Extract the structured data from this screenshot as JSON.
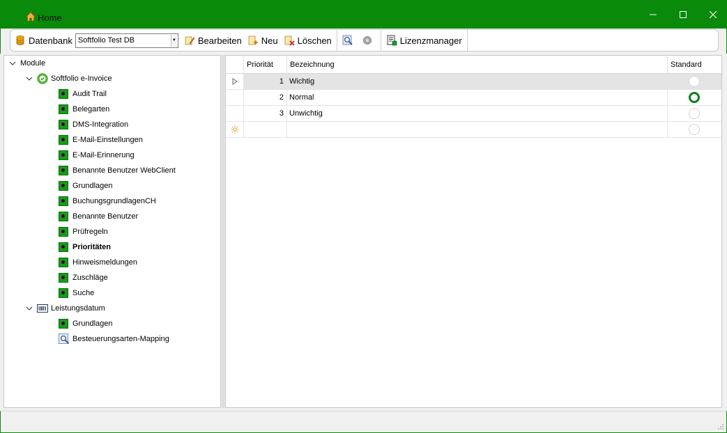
{
  "window": {
    "title": "Home",
    "accent_color": "#0a8a0a"
  },
  "toolbar": {
    "db_label": "Datenbank",
    "db_value": "Softfolio Test DB",
    "edit_label": "Bearbeiten",
    "new_label": "Neu",
    "delete_label": "Löschen",
    "license_label": "Lizenzmanager"
  },
  "tree": {
    "root": "Module",
    "einvoice": {
      "label": "Softfolio e-Invoice",
      "items": [
        "Audit Trail",
        "Belegarten",
        "DMS-Integration",
        "E-Mail-Einstellungen",
        "E-Mail-Erinnerung",
        "Benannte Benutzer WebClient",
        "Grundlagen",
        "BuchungsgrundlagenCH",
        "Benannte Benutzer",
        "Prüfregeln",
        "Prioritäten",
        "Hinweismeldungen",
        "Zuschläge",
        "Suche"
      ],
      "selected": "Prioritäten"
    },
    "leistung": {
      "label": "Leistungsdatum",
      "items": [
        "Grundlagen",
        "Besteuerungsarten-Mapping"
      ]
    }
  },
  "grid": {
    "columns": [
      "Priorität",
      "Bezeichnung",
      "Standard"
    ],
    "rows": [
      {
        "prio": "1",
        "name": "Wichtig",
        "standard": false,
        "selected": true
      },
      {
        "prio": "2",
        "name": "Normal",
        "standard": true,
        "selected": false
      },
      {
        "prio": "3",
        "name": "Unwichtig",
        "standard": false,
        "selected": false
      }
    ]
  }
}
